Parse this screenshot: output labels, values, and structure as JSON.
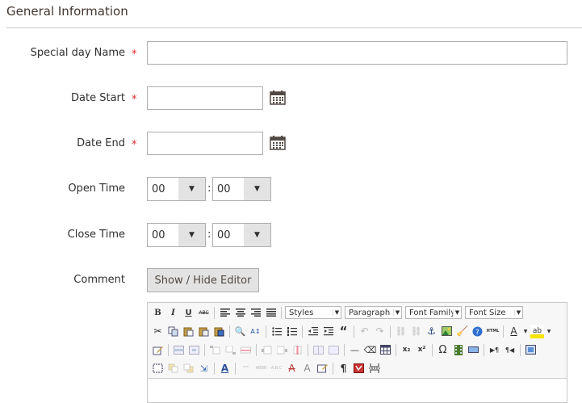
{
  "section": {
    "title": "General Information"
  },
  "fields": {
    "special_day_name": {
      "label": "Special day Name",
      "required_mark": "*",
      "value": ""
    },
    "date_start": {
      "label": "Date Start",
      "required_mark": "*",
      "value": ""
    },
    "date_end": {
      "label": "Date End",
      "required_mark": "*",
      "value": ""
    },
    "open_time": {
      "label": "Open Time",
      "hour": "00",
      "minute": "00",
      "separator": ":"
    },
    "close_time": {
      "label": "Close Time",
      "hour": "00",
      "minute": "00",
      "separator": ":"
    },
    "comment": {
      "label": "Comment",
      "toggle_button": "Show / Hide Editor"
    }
  },
  "editor": {
    "styles_select": "Styles",
    "format_select": "Paragraph",
    "font_family_select": "Font Family",
    "font_size_select": "Font Size",
    "button_glyphs": {
      "bold": "B",
      "italic": "I",
      "underline": "U",
      "strike": "ABC",
      "html": "HTML",
      "omega": "Ω",
      "pilcrow": "¶",
      "quote": "“",
      "font_color": "A",
      "highlight": "ab",
      "subscript": "x₂",
      "superscript": "x²",
      "hr": "—",
      "abbr": "ABBR",
      "acronym": "A.B.C",
      "cite": "“”",
      "style_a": "A",
      "style_a2": "A",
      "ins_a": "A"
    }
  },
  "colors": {
    "required": "#e22626",
    "border": "#adadad",
    "button_bg": "#e3e3e3",
    "title": "#41362f"
  }
}
